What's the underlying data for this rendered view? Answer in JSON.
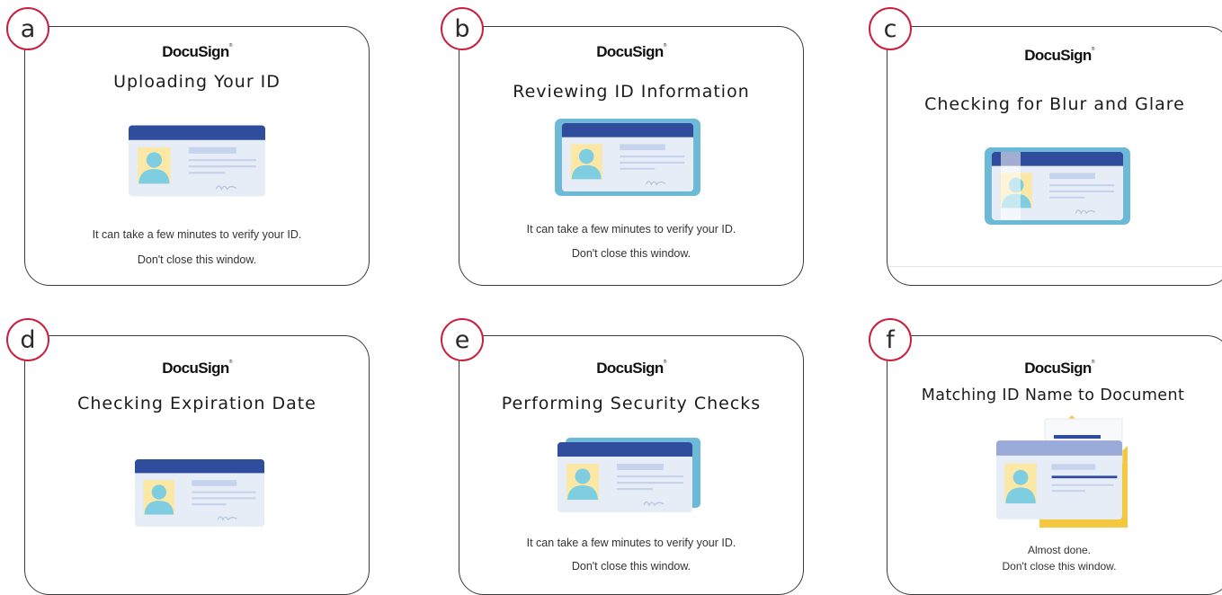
{
  "panels": [
    {
      "letter": "a",
      "brand": "DocuSign",
      "title": "Uploading Your ID",
      "line1": "It can take a few minutes to verify your ID.",
      "line2": "Don't close this window."
    },
    {
      "letter": "b",
      "brand": "DocuSign",
      "title": "Reviewing ID Information",
      "line1": "It can take a few minutes to verify your ID.",
      "line2": "Don't close this window."
    },
    {
      "letter": "c",
      "brand": "DocuSign",
      "title": "Checking for Blur and Glare"
    },
    {
      "letter": "d",
      "brand": "DocuSign",
      "title": "Checking Expiration Date"
    },
    {
      "letter": "e",
      "brand": "DocuSign",
      "title": "Performing Security Checks",
      "line1": "It can take a few minutes to verify your ID.",
      "line2": "Don't close this window."
    },
    {
      "letter": "f",
      "brand": "DocuSign",
      "title": "Matching ID Name to Document",
      "line1": "Almost done.",
      "line2": "Don't close this window."
    }
  ],
  "colors": {
    "badge_border": "#c8203f",
    "card_header": "#2f4d9c",
    "card_body": "#e7edf7",
    "photo_bg": "#fbe7a6",
    "person": "#7fcde0",
    "frame_highlight": "#6cb9d8",
    "document_yellow": "#f5c842"
  },
  "icons": [
    "id-card-icon",
    "document-icon",
    "envelope-icon",
    "signature-icon",
    "person-silhouette-icon"
  ]
}
